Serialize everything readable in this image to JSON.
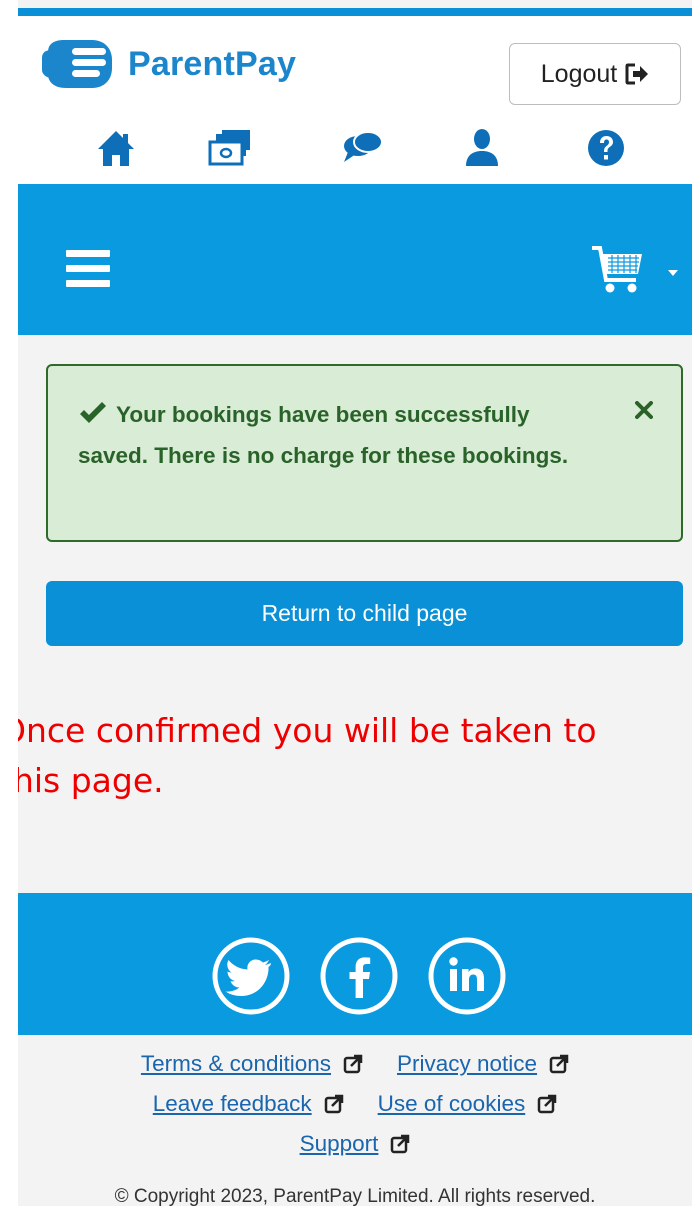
{
  "brand": {
    "name": "ParentPay"
  },
  "header": {
    "logout_label": "Logout",
    "nav_icons": [
      "home-icon",
      "payments-icon",
      "messages-icon",
      "profile-icon",
      "help-icon"
    ]
  },
  "alert": {
    "message": "Your bookings have been successfully saved. There is no charge for these bookings."
  },
  "actions": {
    "return_label": "Return to child page"
  },
  "annotation": {
    "line1": "Once confirmed you will be taken to",
    "line2": "this page."
  },
  "footer": {
    "social": [
      "twitter-icon",
      "facebook-icon",
      "linkedin-icon"
    ],
    "links": {
      "terms": "Terms & conditions",
      "privacy": "Privacy notice",
      "feedback": "Leave feedback",
      "cookies": "Use of cookies",
      "support": "Support"
    },
    "copyright": "© Copyright 2023, ParentPay Limited. All rights reserved."
  },
  "colors": {
    "primary": "#0a9ae0",
    "success_bg": "#d9ecd6",
    "success_text": "#2a632a",
    "annotation": "#ee0000"
  }
}
